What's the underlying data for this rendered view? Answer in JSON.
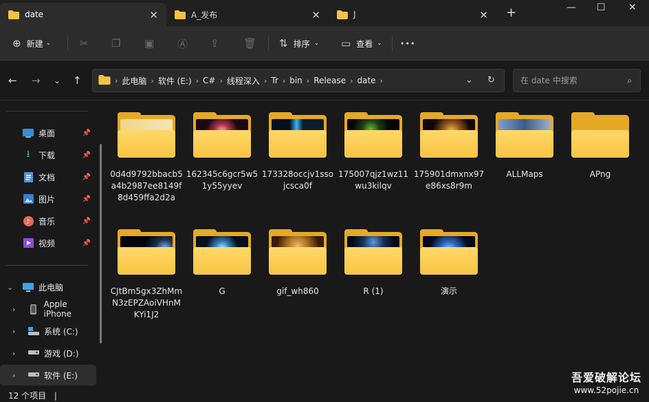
{
  "tabs": [
    {
      "label": "date",
      "active": true
    },
    {
      "label": "A_发布",
      "active": false
    },
    {
      "label": "J",
      "active": false
    }
  ],
  "window": {
    "new_tab": "+",
    "minimize": "—",
    "maximize": "☐",
    "close": "✕"
  },
  "toolbar": {
    "new_label": "新建",
    "sort_label": "排序",
    "view_label": "查看",
    "more": "•••"
  },
  "address": {
    "crumbs": [
      "此电脑",
      "软件 (E:)",
      "C#",
      "线程深入",
      "Tr",
      "bin",
      "Release",
      "date"
    ]
  },
  "search": {
    "placeholder": "在 date 中搜索"
  },
  "sidebar": {
    "quick": [
      {
        "label": "桌面",
        "icon": "desktop-icon"
      },
      {
        "label": "下载",
        "icon": "download-icon"
      },
      {
        "label": "文档",
        "icon": "document-icon"
      },
      {
        "label": "图片",
        "icon": "picture-icon"
      },
      {
        "label": "音乐",
        "icon": "music-icon"
      },
      {
        "label": "视频",
        "icon": "video-icon"
      }
    ],
    "tree": [
      {
        "label": "此电脑",
        "icon": "pc-icon"
      },
      {
        "label": "Apple iPhone",
        "icon": "phone-icon"
      },
      {
        "label": "系统 (C:)",
        "icon": "drive-icon"
      },
      {
        "label": "游戏 (D:)",
        "icon": "drive-icon"
      },
      {
        "label": "软件 (E:)",
        "icon": "drive-icon"
      }
    ]
  },
  "files": [
    {
      "name": "0d4d9792bbacb5a4b2987ee8149f8d459ffa2d2a",
      "thumb": "linear-gradient(90deg,#f0d58a,#f3e4b8)"
    },
    {
      "name": "162345c6gcr5w51y55yyev",
      "thumb": "radial-gradient(circle at 50% 60%,#ffb0c0 0%,#b03050 25%,#1a0a10 55%)"
    },
    {
      "name": "173328occjv1ssojcsca0f",
      "thumb": "linear-gradient(90deg,#05101c 35%,#38b4f5 48%,#0a1c2e 60%)"
    },
    {
      "name": "175007qjz1wz11wu3kilqv",
      "thumb": "radial-gradient(circle at 45% 50%,#5fbf3a 0%,#1b3b12 30%,#050805 60%)"
    },
    {
      "name": "175901dmxnx97e86xs8r9m",
      "thumb": "radial-gradient(circle at 55% 60%,#f0c060 0%,#8a5018 30%,#100808 60%)"
    },
    {
      "name": "ALLMaps",
      "thumb": "linear-gradient(90deg,#7a9fd0,#3e5a8a,#9bb0c8)"
    },
    {
      "name": "APng",
      "thumb": ""
    },
    {
      "name": "CJtBm5gx3ZhMmN3zEPZAoiVHnMKYi1J2",
      "thumb": "radial-gradient(circle at 85% 60%,#7fb8f0 0%,#1a3050 20%,#02050a 45%)"
    },
    {
      "name": "G",
      "thumb": "radial-gradient(circle at 50% 60%,#c8ecff 0%,#2f7ab8 25%,#06101c 55%)"
    },
    {
      "name": "gif_wh860",
      "thumb": "radial-gradient(circle at 50% 50%,#f0c060 0%,#a06820 40%,#3a1a05 75%)"
    },
    {
      "name": "R (1)",
      "thumb": "radial-gradient(circle at 50% 30%,#5a9ae0 0%,#14305a 35%,#040814 70%)"
    },
    {
      "name": "演示",
      "thumb": "radial-gradient(circle at 50% 70%,#9ed8ff 0%,#2a66c0 30%,#040a18 65%)"
    }
  ],
  "status": {
    "count": "12 个项目",
    "cursor": "|"
  },
  "watermark": {
    "line1": "吾爱破解论坛",
    "line2": "www.52pojie.cn"
  }
}
